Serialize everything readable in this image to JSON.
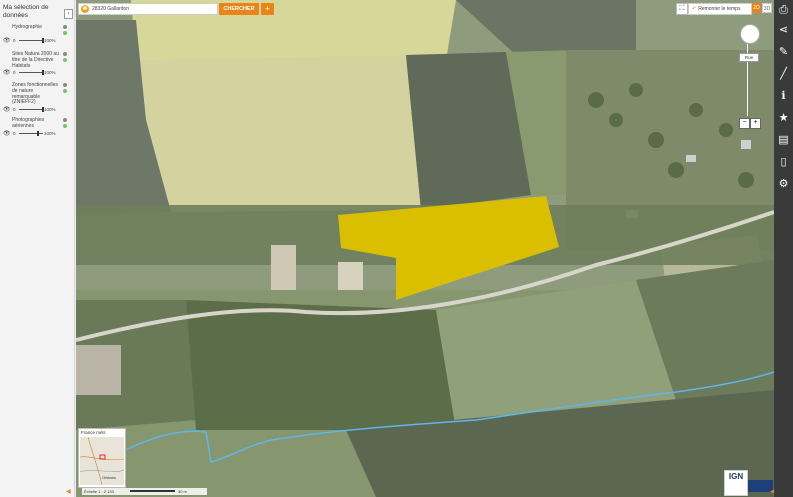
{
  "sidebar": {
    "title": "Ma sélection de données",
    "collapse_icon": "chevron-left-icon",
    "layers": [
      {
        "name": "Hydrographie",
        "min": "0",
        "max": "100%",
        "opacity": 1.0
      },
      {
        "name": "Sites Natura 2000 au titre de la Directive Habitats",
        "min": "0",
        "max": "100%",
        "opacity": 1.0
      },
      {
        "name": "Zones fonctionnelles de nature remarquable (ZNIEFF2)",
        "min": "0",
        "max": "100%",
        "opacity": 1.0
      },
      {
        "name": "Photographies aériennes",
        "min": "0",
        "max": "100%",
        "opacity": 0.78
      }
    ]
  },
  "search": {
    "value": "28320 Gallardon",
    "button_label": "CHERCHER",
    "plus_label": "+"
  },
  "toolbar": {
    "time_label": "Remonter le temps",
    "view_2d": "2D",
    "view_3d": "3D"
  },
  "navigation": {
    "zoom_label": "Rue",
    "zoom_minus": "−",
    "zoom_plus": "+"
  },
  "overview": {
    "title": "France métr.",
    "place_label": "Orléans"
  },
  "scale": {
    "label": "Échelle 1 : 2 133",
    "unit": "30 m"
  },
  "logo": {
    "text": "IGN"
  },
  "right_toolbar": {
    "icons": [
      "print-icon",
      "share-icon",
      "pencil-icon",
      "measure-icon",
      "info-icon",
      "star-icon",
      "map-book-icon",
      "document-icon",
      "gear-icon"
    ]
  },
  "colors": {
    "accent": "#e8841a",
    "parcel": "#d9bf00",
    "river": "#5fb6e8",
    "rightbar": "#3a3a3a"
  }
}
